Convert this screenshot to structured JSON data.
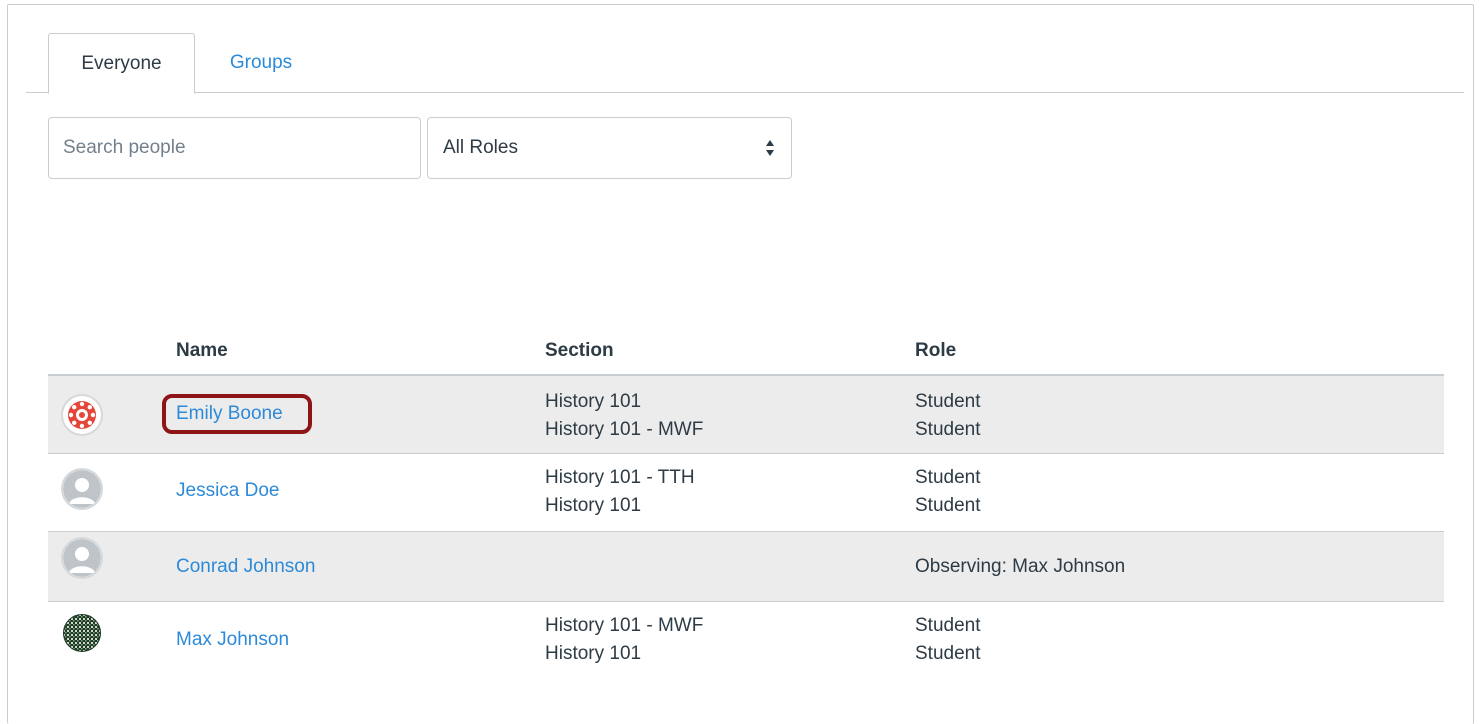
{
  "tabs": [
    {
      "label": "Everyone",
      "active": true
    },
    {
      "label": "Groups",
      "active": false
    }
  ],
  "filters": {
    "search_placeholder": "Search people",
    "role_selected": "All Roles"
  },
  "table": {
    "headers": {
      "name": "Name",
      "section": "Section",
      "role": "Role"
    },
    "rows": [
      {
        "avatar": "canvas-logo-avatar",
        "name": "Emily Boone",
        "sections": [
          "History 101",
          "History 101 - MWF"
        ],
        "roles": [
          "Student",
          "Student"
        ],
        "highlighted": true
      },
      {
        "avatar": "default-user-avatar",
        "name": "Jessica Doe",
        "sections": [
          "History 101 - TTH",
          "History 101"
        ],
        "roles": [
          "Student",
          "Student"
        ]
      },
      {
        "avatar": "default-user-avatar",
        "name": "Conrad Johnson",
        "sections": [],
        "roles": [
          "Observing: Max Johnson"
        ]
      },
      {
        "avatar": "pattern-avatar",
        "name": "Max Johnson",
        "sections": [
          "History 101 - MWF",
          "History 101"
        ],
        "roles": [
          "Student",
          "Student"
        ]
      }
    ]
  },
  "colors": {
    "link": "#2d8ad8",
    "text": "#2d3b45",
    "border": "#c7cdd1",
    "row_shade": "#ececec",
    "highlight": "#8e1517"
  }
}
